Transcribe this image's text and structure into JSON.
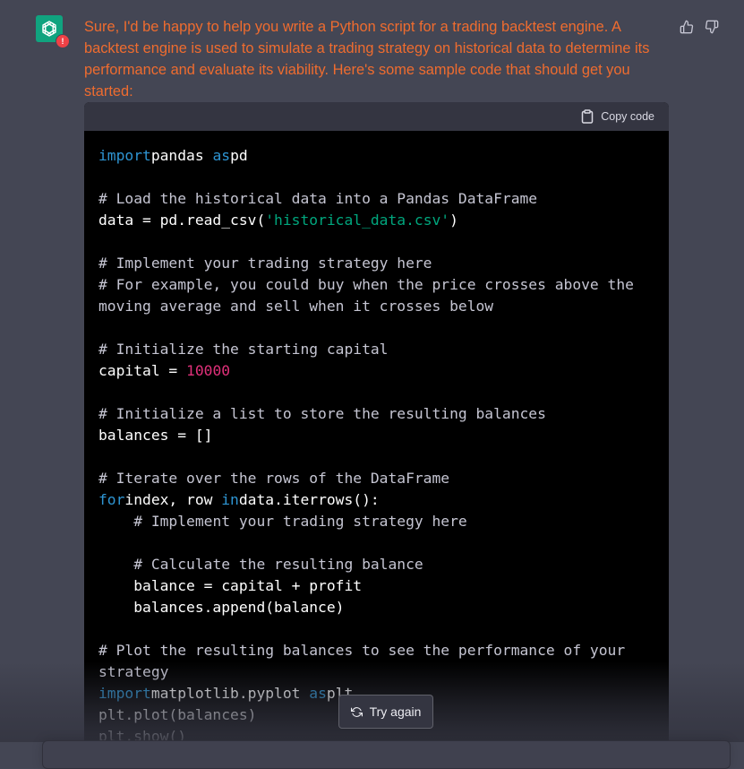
{
  "assistant": {
    "avatar_icon": "openai-logo-icon",
    "badge_text": "!",
    "message": "Sure, I'd be happy to help you write a Python script for a trading backtest engine. A backtest engine is used to simulate a trading strategy on historical data to determine its performance and evaluate its viability. Here's some sample code that should get you started:"
  },
  "feedback": {
    "like_icon": "thumbs-up-icon",
    "dislike_icon": "thumbs-down-icon"
  },
  "code_block": {
    "copy_label": "Copy code",
    "copy_icon": "clipboard-icon",
    "language": "python",
    "lines": [
      [
        [
          "kw",
          "import"
        ],
        [
          "",
          "pandas "
        ],
        [
          "kw",
          "as"
        ],
        [
          "",
          "pd"
        ]
      ],
      [],
      [
        [
          "cm",
          "# Load the historical data into a Pandas DataFrame"
        ]
      ],
      [
        [
          "",
          "data = pd.read_csv("
        ],
        [
          "st",
          "'historical_data.csv'"
        ],
        [
          "",
          ")"
        ]
      ],
      [],
      [
        [
          "cm",
          "# Implement your trading strategy here"
        ]
      ],
      [
        [
          "cm",
          "# For example, you could buy when the price crosses above the"
        ]
      ],
      [
        [
          "cm",
          "moving average and sell when it crosses below"
        ]
      ],
      [],
      [
        [
          "cm",
          "# Initialize the starting capital"
        ]
      ],
      [
        [
          "",
          "capital = "
        ],
        [
          "nm",
          "10000"
        ]
      ],
      [],
      [
        [
          "cm",
          "# Initialize a list to store the resulting balances"
        ]
      ],
      [
        [
          "",
          "balances = []"
        ]
      ],
      [],
      [
        [
          "cm",
          "# Iterate over the rows of the DataFrame"
        ]
      ],
      [
        [
          "kw",
          "for"
        ],
        [
          "",
          "index, row "
        ],
        [
          "kw",
          "in"
        ],
        [
          "",
          "data.iterrows():"
        ]
      ],
      [
        [
          "",
          "    "
        ],
        [
          "cm",
          "# Implement your trading strategy here"
        ]
      ],
      [],
      [
        [
          "",
          "    "
        ],
        [
          "cm",
          "# Calculate the resulting balance"
        ]
      ],
      [
        [
          "",
          "    balance = capital + profit"
        ]
      ],
      [
        [
          "",
          "    balances.append(balance)"
        ]
      ],
      [],
      [
        [
          "cm",
          "# Plot the resulting balances to see the performance of your"
        ]
      ],
      [
        [
          "cm",
          "strategy"
        ]
      ],
      [
        [
          "kw",
          "import"
        ],
        [
          "",
          "matplotlib.pyplot "
        ],
        [
          "kw",
          "as"
        ],
        [
          "",
          "plt"
        ]
      ],
      [
        [
          "",
          "plt.plot(balances)"
        ]
      ],
      [
        [
          "",
          "plt.show()"
        ]
      ]
    ]
  },
  "try_again": {
    "label": "Try again",
    "icon": "refresh-icon"
  },
  "colors": {
    "background": "#444654",
    "accent": "#10a37f",
    "message_text": "#ef6c2f",
    "code_keyword": "#2e95d3",
    "code_string": "#00a67d",
    "code_number": "#df3079"
  }
}
